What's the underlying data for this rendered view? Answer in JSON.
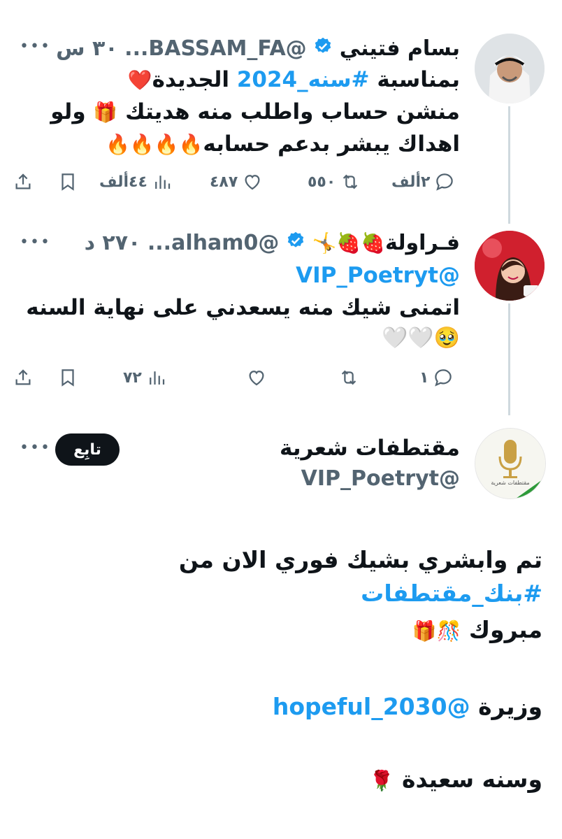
{
  "tweet1": {
    "name": "بسام فتيني",
    "handle": "@BASSAM_FA...",
    "time": "٣٠ س",
    "line1_pre": "بمناسبة",
    "line1_hashtag": "#سنه_2024",
    "line1_post": "الجديدة",
    "line1_emoji": "❤️",
    "line2_text": "منشن حساب واطلب منه هديتك",
    "line2_emoji": "🎁",
    "line2_end": "ولو",
    "line3_text": "اهداك يبشر بدعم حسابه",
    "line3_emoji": "🔥🔥🔥🔥",
    "replies": "٢ألف",
    "retweets": "٥٥٠",
    "likes": "٤٨٧",
    "views": "٤٤ألف"
  },
  "tweet2": {
    "name": "فـراولة",
    "name_emoji": "🍓🍓🤸",
    "handle": "@alham0...",
    "time": "٢٧٠ د",
    "mention": "@VIP_Poetryt",
    "line1": "اتمنى شيك منه يسعدني على نهاية السنه",
    "line2_emoji": "🥹🤍🤍",
    "replies": "١",
    "views": "٧٢"
  },
  "tweet3": {
    "name": "مقتطفات شعرية",
    "handle": "@VIP_Poetryt",
    "follow_label": "تابِع",
    "avatar_text": "مقتطفات شعرية",
    "line1": "تم وابشري بشيك فوري الان من",
    "hashtag": "#بنك_مقتطفات",
    "line3": "مبروك",
    "line3_emoji": "🎊🎁",
    "line4_pre": "وزيرة",
    "line4_mention": "@hopeful_2030",
    "line5": "وسنه سعيدة",
    "line5_emoji": "🌹"
  },
  "colors": {
    "link": "#1d9bf0",
    "verified": "#1d9bf0",
    "muted": "#536471",
    "thread_line": "#cfd9de"
  },
  "icons": [
    "more-icon",
    "verified-icon",
    "reply-icon",
    "retweet-icon",
    "like-icon",
    "views-icon",
    "bookmark-icon",
    "share-icon"
  ]
}
